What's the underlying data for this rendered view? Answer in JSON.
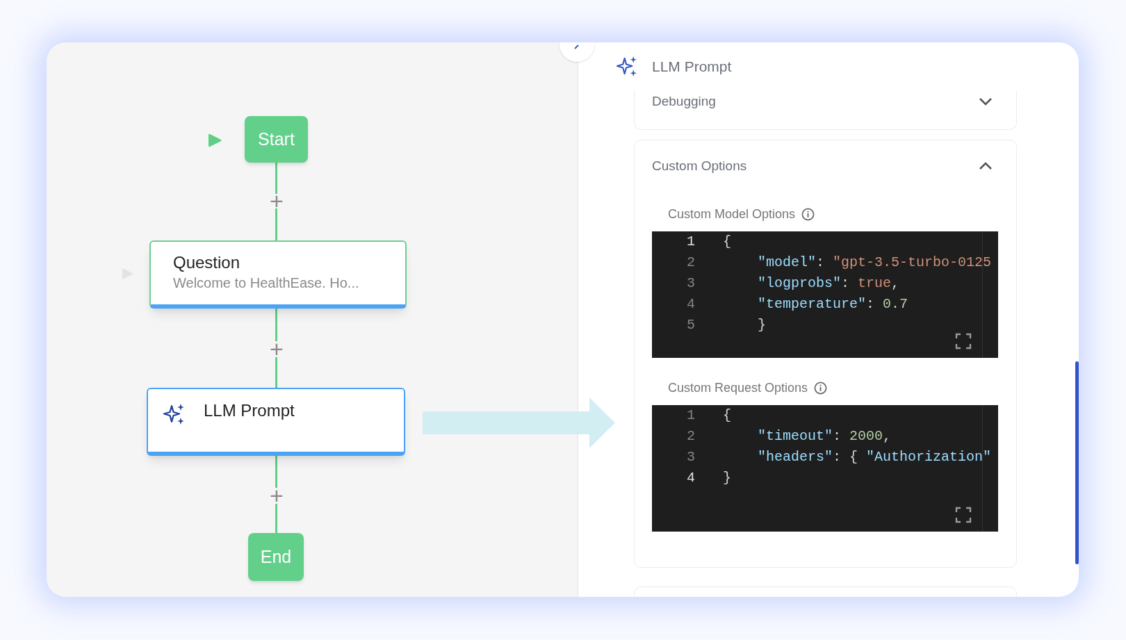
{
  "flow": {
    "nodes": [
      {
        "kind": "start",
        "label": "Start"
      },
      {
        "kind": "question",
        "title": "Question",
        "subtitle": "Welcome to HealthEase. Ho...",
        "selected": false
      },
      {
        "kind": "llm",
        "title": "LLM Prompt",
        "selected": true
      },
      {
        "kind": "end",
        "label": "End"
      }
    ],
    "add_buttons": [
      "+",
      "+",
      "+"
    ]
  },
  "panel": {
    "title": "LLM Prompt",
    "sections": [
      {
        "title": "Debugging",
        "expanded": false
      },
      {
        "title": "Custom Options",
        "expanded": true,
        "editors": [
          {
            "label": "Custom Model Options",
            "lines": [
              {
                "number": "1",
                "active": true,
                "indented": false,
                "tokens": [
                  {
                    "kind": "punct",
                    "text": "{"
                  }
                ]
              },
              {
                "number": "2",
                "active": false,
                "indented": true,
                "tokens": [
                  {
                    "kind": "key",
                    "text": "\"model\""
                  },
                  {
                    "kind": "punct",
                    "text": ": "
                  },
                  {
                    "kind": "string",
                    "text": "\"gpt-3.5-turbo-0125"
                  }
                ]
              },
              {
                "number": "3",
                "active": false,
                "indented": true,
                "tokens": [
                  {
                    "kind": "key",
                    "text": "\"logprobs\""
                  },
                  {
                    "kind": "punct",
                    "text": ": "
                  },
                  {
                    "kind": "bool",
                    "text": "true"
                  },
                  {
                    "kind": "punct",
                    "text": ","
                  }
                ]
              },
              {
                "number": "4",
                "active": false,
                "indented": true,
                "tokens": [
                  {
                    "kind": "key",
                    "text": "\"temperature\""
                  },
                  {
                    "kind": "punct",
                    "text": ": "
                  },
                  {
                    "kind": "number",
                    "text": "0.7"
                  }
                ]
              },
              {
                "number": "5",
                "active": false,
                "indented": true,
                "tokens": [
                  {
                    "kind": "punct",
                    "text": "}"
                  }
                ]
              }
            ]
          },
          {
            "label": "Custom Request Options",
            "lines": [
              {
                "number": "1",
                "active": false,
                "indented": false,
                "tokens": [
                  {
                    "kind": "punct",
                    "text": "{"
                  }
                ]
              },
              {
                "number": "2",
                "active": false,
                "indented": true,
                "tokens": [
                  {
                    "kind": "key",
                    "text": "\"timeout\""
                  },
                  {
                    "kind": "punct",
                    "text": ": "
                  },
                  {
                    "kind": "number",
                    "text": "2000"
                  },
                  {
                    "kind": "punct",
                    "text": ","
                  }
                ]
              },
              {
                "number": "3",
                "active": false,
                "indented": true,
                "tokens": [
                  {
                    "kind": "key",
                    "text": "\"headers\""
                  },
                  {
                    "kind": "punct",
                    "text": ": { "
                  },
                  {
                    "kind": "key",
                    "text": "\"Authorization\""
                  }
                ]
              },
              {
                "number": "4",
                "active": true,
                "indented": false,
                "tokens": [
                  {
                    "kind": "punct",
                    "text": "}"
                  }
                ]
              }
            ]
          }
        ]
      }
    ]
  }
}
